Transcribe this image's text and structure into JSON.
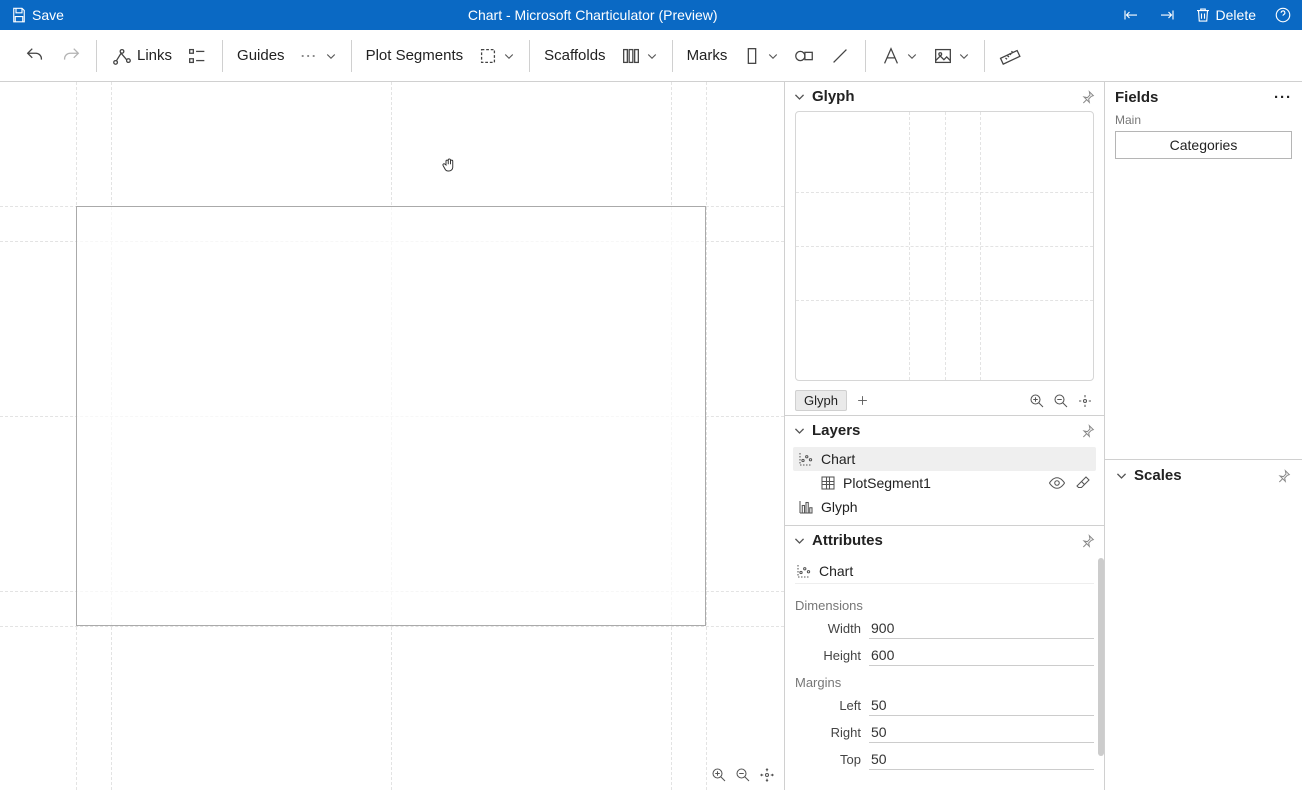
{
  "titlebar": {
    "save": "Save",
    "title": "Chart - Microsoft Charticulator (Preview)",
    "delete": "Delete"
  },
  "toolbar": {
    "links": "Links",
    "guides": "Guides",
    "plotSegments": "Plot Segments",
    "scaffolds": "Scaffolds",
    "marks": "Marks"
  },
  "panels": {
    "glyph": "Glyph",
    "glyphTab": "Glyph",
    "layers": "Layers",
    "attributes": "Attributes",
    "fields": "Fields",
    "fieldsMain": "Main",
    "scales": "Scales"
  },
  "layers": {
    "chart": "Chart",
    "plotSegment1": "PlotSegment1",
    "glyph": "Glyph"
  },
  "attributes": {
    "chartLabel": "Chart",
    "dimensionsLabel": "Dimensions",
    "widthLabel": "Width",
    "widthValue": "900",
    "heightLabel": "Height",
    "heightValue": "600",
    "marginsLabel": "Margins",
    "leftLabel": "Left",
    "leftValue": "50",
    "rightLabel": "Right",
    "rightValue": "50",
    "topLabel": "Top",
    "topValue": "50"
  },
  "fields": {
    "categories": "Categories"
  }
}
